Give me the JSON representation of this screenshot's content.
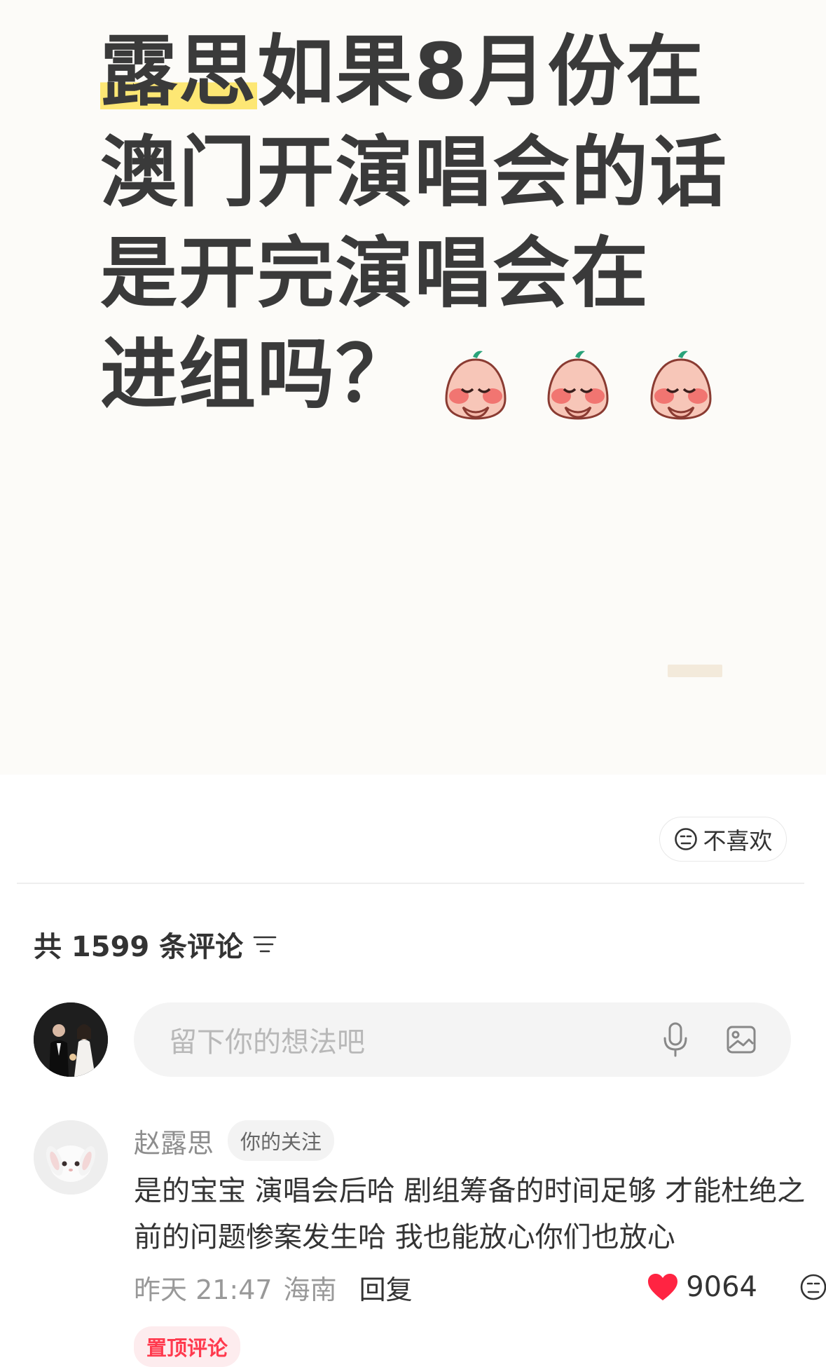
{
  "post": {
    "title_highlight": "露思",
    "title_line1_rest": "如果8月份在",
    "title_line2": "澳门开演唱会的话",
    "title_line3": "是开完演唱会在",
    "title_line4": "进组吗？",
    "emoji_count": 3
  },
  "actions": {
    "dislike_label": "不喜欢"
  },
  "comments_header": {
    "count_text": "共 1599 条评论"
  },
  "comment_input": {
    "placeholder": "留下你的想法吧"
  },
  "pinned_comment": {
    "author": "赵露思",
    "badge": "你的关注",
    "text": "是的宝宝 演唱会后哈 剧组筹备的时间足够 才能杜绝之前的问题惨案发生哈 我也能放心你们也放心",
    "time": "昨天 21:47",
    "location": "海南",
    "reply_label": "回复",
    "likes": "9064",
    "pin_label": "置顶评论"
  },
  "colors": {
    "highlight": "#fde774",
    "like_red": "#ff2442",
    "pin_red": "#ff3a4e"
  },
  "icons": [
    "sad-face-icon",
    "sort-icon",
    "microphone-icon",
    "image-icon",
    "heart-icon",
    "emoji-face-icon"
  ]
}
